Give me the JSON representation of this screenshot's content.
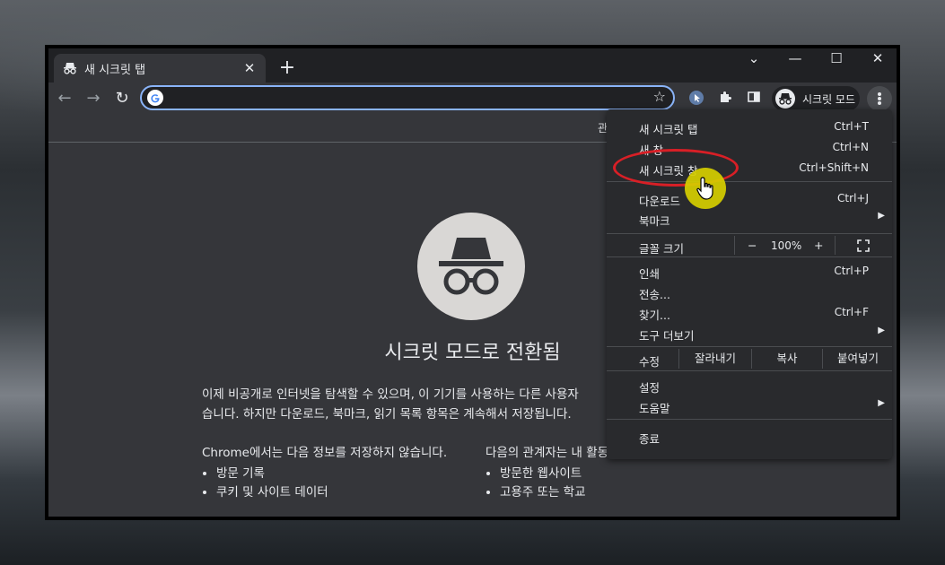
{
  "tab": {
    "title": "새 시크릿 탭",
    "close": "✕"
  },
  "window_controls": {
    "minimize": "—",
    "maximize": "☐",
    "close": "✕",
    "tab_search": "⌄"
  },
  "toolbar": {
    "back": "←",
    "forward": "→",
    "reload": "↻",
    "star": "☆"
  },
  "omnibox": {
    "value": "",
    "placeholder": ""
  },
  "profile": {
    "label": "시크릿 모드"
  },
  "bookmark_bar": {
    "text": "관"
  },
  "page": {
    "headline": "시크릿 모드로 전환됨",
    "intro_line1": "이제 비공개로 인터넷을 탐색할 수 있으며, 이 기기를 사용하는 다른 사용자",
    "intro_line2": "습니다. 하지만 다운로드, 북마크, 읽기 목록 항목은 계속해서 저장됩니다.",
    "left_col": {
      "title": "Chrome에서는 다음 정보를 저장하지 않습니다.",
      "items": [
        "방문 기록",
        "쿠키 및 사이트 데이터"
      ]
    },
    "right_col": {
      "title": "다음의 관계자는 내 활동이 표시될 수 있습니다.",
      "items": [
        "방문한 웹사이트",
        "고용주 또는 학교"
      ]
    }
  },
  "menu": {
    "new_tab": {
      "label": "새 시크릿 탭",
      "shortcut": "Ctrl+T"
    },
    "new_window": {
      "label": "새 창",
      "shortcut": "Ctrl+N"
    },
    "new_incognito": {
      "label": "새 시크릿 창",
      "shortcut": "Ctrl+Shift+N"
    },
    "downloads": {
      "label": "다운로드",
      "shortcut": "Ctrl+J"
    },
    "bookmarks": {
      "label": "북마크",
      "arrow": "▶"
    },
    "zoom": {
      "label": "글꼴 크기",
      "minus": "−",
      "value": "100%",
      "plus": "+"
    },
    "print": {
      "label": "인쇄",
      "shortcut": "Ctrl+P"
    },
    "cast": {
      "label": "전송..."
    },
    "find": {
      "label": "찾기...",
      "shortcut": "Ctrl+F"
    },
    "more_tools": {
      "label": "도구 더보기",
      "arrow": "▶"
    },
    "edit": {
      "label": "수정",
      "cut": "잘라내기",
      "copy": "복사",
      "paste": "붙여넣기"
    },
    "settings": {
      "label": "설정"
    },
    "help": {
      "label": "도움말",
      "arrow": "▶"
    },
    "exit": {
      "label": "종료"
    }
  },
  "colors": {
    "accent": "#8ab4f8",
    "highlight": "#d81f26",
    "cursor_halo": "#d6ce00"
  }
}
